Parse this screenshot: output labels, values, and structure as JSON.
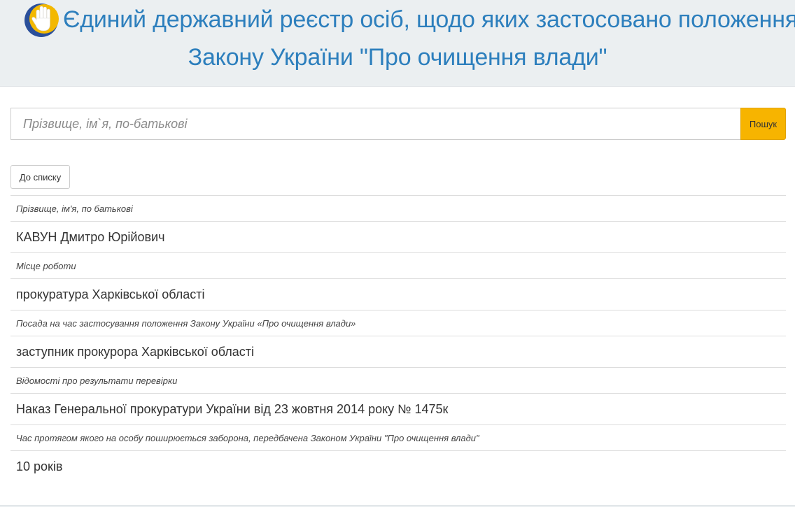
{
  "header": {
    "title_line1": "Єдиний державний реєстр осіб, щодо яких застосовано положення",
    "title_line2": "Закону України \"Про очищення влади\"",
    "logo_icon": "hand-stop-icon",
    "colors": {
      "title": "#2d7fbd",
      "logo_blue": "#2a4f9a",
      "logo_yellow": "#f3b800"
    }
  },
  "search": {
    "placeholder": "Прізвище, ім`я, по-батькові",
    "value": "",
    "button_label": "Пошук",
    "button_color": "#f7b400"
  },
  "back_button_label": "До списку",
  "details": [
    {
      "label": "Прізвище, ім'я, по батькові",
      "value": "КАВУН Дмитро Юрійович"
    },
    {
      "label": "Місце роботи",
      "value": "прокуратура Харківської області"
    },
    {
      "label": "Посада на час застосування положення Закону України «Про очищення влади»",
      "value": "заступник прокурора Харківської області"
    },
    {
      "label": "Відомості про результати перевірки",
      "value": "Наказ Генеральної прокуратури України від 23 жовтня 2014 року № 1475к"
    },
    {
      "label": "Час протягом якого на особу поширюється заборона, передбачена Законом України \"Про очищення влади\"",
      "value": "10 років"
    }
  ]
}
